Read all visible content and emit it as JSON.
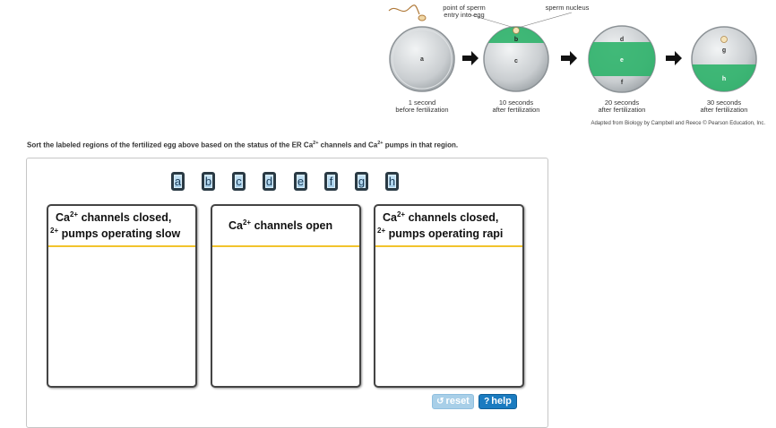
{
  "figure": {
    "labels": {
      "sperm_entry": [
        "point of sperm",
        "entry into egg"
      ],
      "sperm_nucleus": "sperm nucleus",
      "region_letters": [
        "a",
        "b",
        "c",
        "d",
        "e",
        "f",
        "g",
        "h"
      ]
    },
    "captions": [
      [
        "1 second",
        "before fertilization"
      ],
      [
        "10 seconds",
        "after fertilization"
      ],
      [
        "20 seconds",
        "after fertilization"
      ],
      [
        "30 seconds",
        "after fertilization"
      ]
    ],
    "credit": "Adapted from Biology by Campbell and Reece © Pearson Education, Inc.",
    "colors": {
      "calcium_wave": "#2eb36a",
      "egg": "#cfd3d6"
    }
  },
  "instruction": {
    "part1": "Sort the labeled regions of the fertilized egg above based on the status of the ER Ca",
    "sup1": "2+",
    "part2": " channels and Ca",
    "sup2": "2+",
    "part3": " pumps in that region."
  },
  "tiles": [
    "a",
    "b",
    "c",
    "d",
    "e",
    "f",
    "g",
    "h"
  ],
  "bins": [
    {
      "line1_pre": "Ca",
      "line1_sup": "2+",
      "line1_post": " channels closed,",
      "line2_sup": "2+",
      "line2_post": " pumps operating slow"
    },
    {
      "line1_pre": "Ca",
      "line1_sup": "2+",
      "line1_post": " channels open"
    },
    {
      "line1_pre": "Ca",
      "line1_sup": "2+",
      "line1_post": " channels closed,",
      "line2_sup": "2+",
      "line2_post": " pumps operating rapi"
    }
  ],
  "buttons": {
    "reset": "reset",
    "help": "help"
  }
}
